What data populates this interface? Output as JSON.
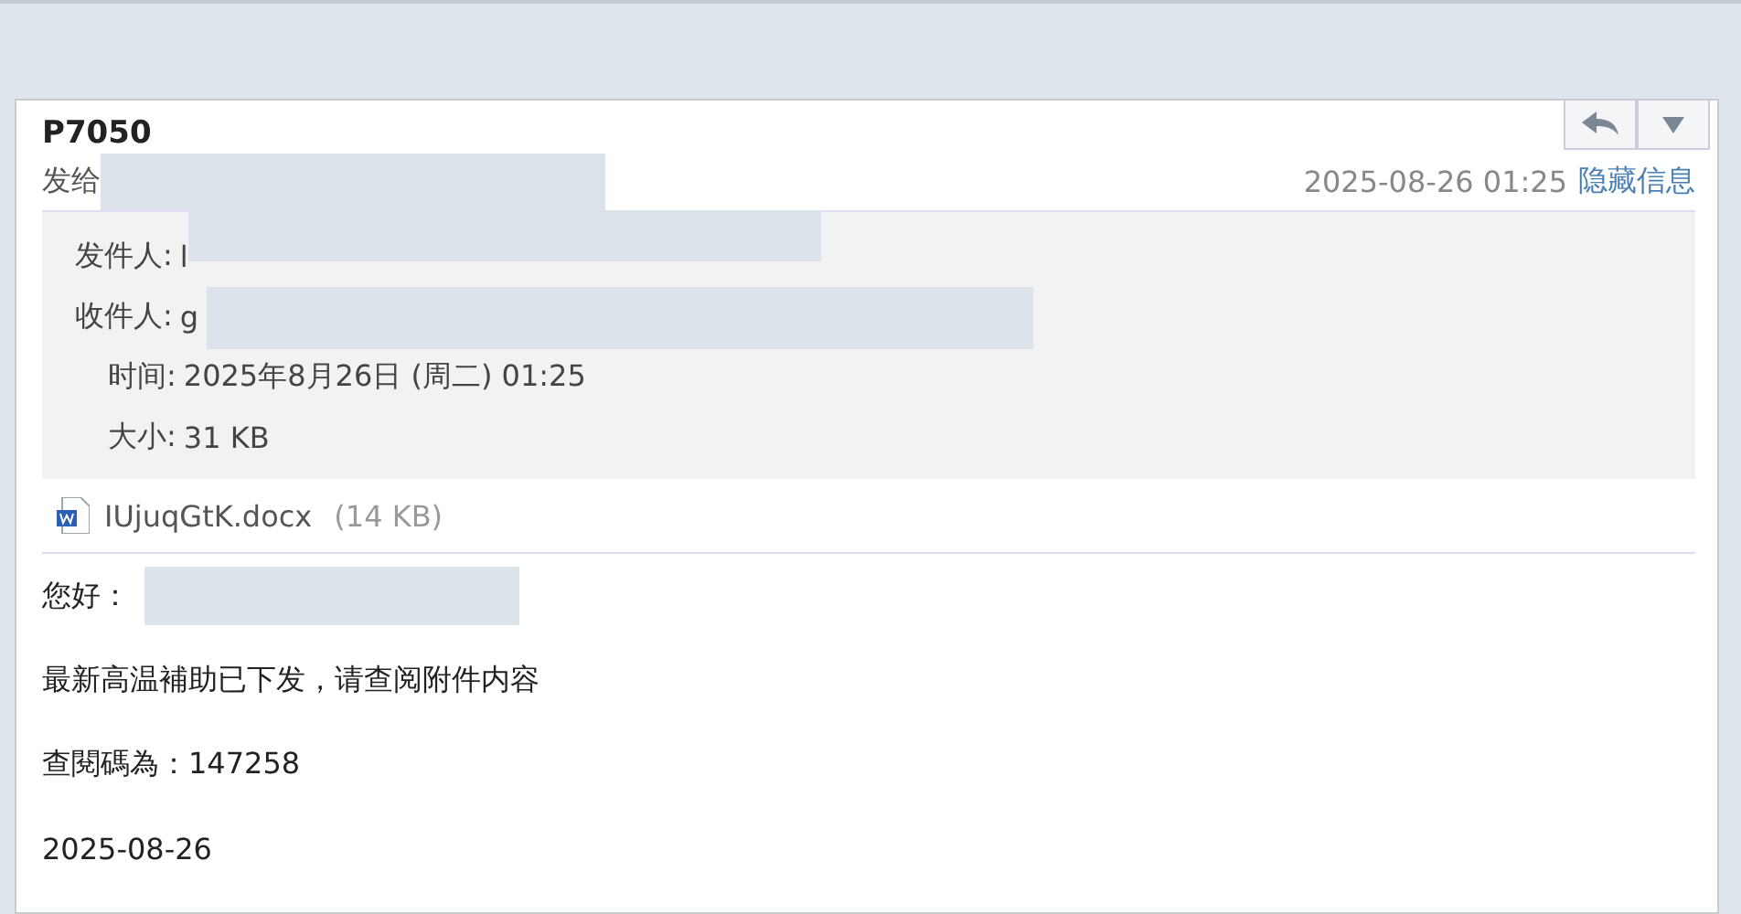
{
  "subject": "P7050",
  "to_label": "发给",
  "date": "2025-08-26 01:25",
  "hide_link": "隐藏信息",
  "details": [
    {
      "label": "发件人:",
      "value": "l"
    },
    {
      "label": "收件人:",
      "value": "g"
    },
    {
      "label": "时间:",
      "value": "2025年8月26日 (周二) 01:25"
    },
    {
      "label": "大小:",
      "value": "31 KB"
    }
  ],
  "attachment": {
    "name": "IUjuqGtK.docx",
    "size": "(14 KB)"
  },
  "body": [
    {
      "text": "您好："
    },
    {
      "text": "最新高温補助已下发，请查阅附件内容"
    },
    {
      "text": "查閱碼為：147258"
    },
    {
      "text": "2025-08-26"
    }
  ]
}
